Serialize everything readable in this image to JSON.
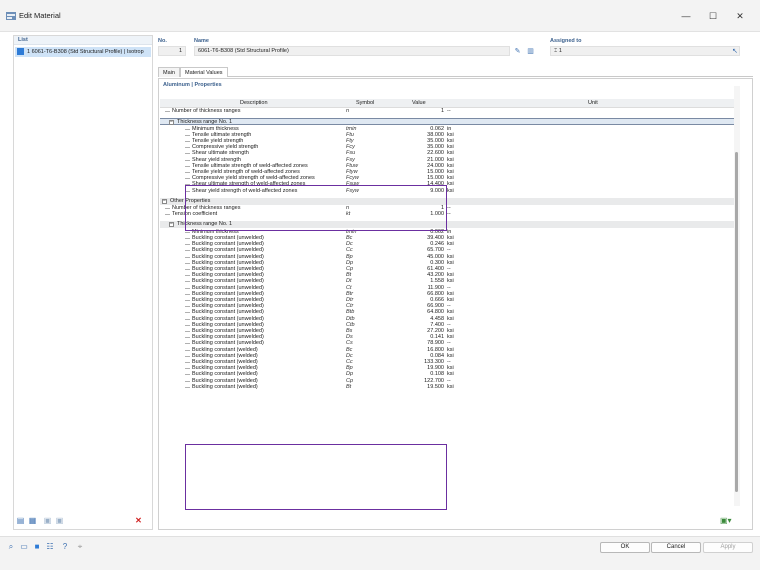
{
  "window": {
    "title": "Edit Material",
    "minimize_glyph": "—",
    "maximize_glyph": "☐",
    "close_glyph": "✕"
  },
  "list_panel": {
    "header": "List",
    "items": [
      {
        "label": "1  6061-T6-B308 (Std Structural Profile) | Isotrop"
      }
    ]
  },
  "header_fields": {
    "no_label": "No.",
    "no_value": "1",
    "name_label": "Name",
    "name_value": "6061-T6-B308 (Std Structural Profile)",
    "assigned_label": "Assigned to",
    "assigned_value": "1"
  },
  "tabs": [
    {
      "label": "Main"
    },
    {
      "label": "Material Values"
    }
  ],
  "section_title": "Aluminum | Properties",
  "columns": {
    "description": "Description",
    "symbol": "Symbol",
    "value": "Value",
    "unit": "Unit"
  },
  "rows": [
    {
      "desc": "Number of thickness ranges",
      "sym": "n",
      "val": "1",
      "unit": "--",
      "indent": 1
    },
    {
      "desc": "Thickness range No. 1",
      "sym": "",
      "val": "",
      "unit": "",
      "group": true,
      "indent": 0
    },
    {
      "desc": "Minimum thickness",
      "sym": "tmin",
      "val": "0.062",
      "unit": "in",
      "indent": 2
    },
    {
      "desc": "Tensile ultimate strength",
      "sym": "Ftu",
      "val": "38.000",
      "unit": "ksi",
      "indent": 2
    },
    {
      "desc": "Tensile yield strength",
      "sym": "Fty",
      "val": "35.000",
      "unit": "ksi",
      "indent": 2
    },
    {
      "desc": "Compressive yield strength",
      "sym": "Fcy",
      "val": "35.000",
      "unit": "ksi",
      "indent": 2
    },
    {
      "desc": "Shear ultimate strength",
      "sym": "Fsu",
      "val": "22.600",
      "unit": "ksi",
      "indent": 2
    },
    {
      "desc": "Shear yield strength",
      "sym": "Fsy",
      "val": "21.000",
      "unit": "ksi",
      "indent": 2
    },
    {
      "desc": "Tensile ultimate strength of weld-affected zones",
      "sym": "Ftuw",
      "val": "24.000",
      "unit": "ksi",
      "indent": 2
    },
    {
      "desc": "Tensile yield strength of weld-affected zones",
      "sym": "Ftyw",
      "val": "15.000",
      "unit": "ksi",
      "indent": 2
    },
    {
      "desc": "Compressive yield strength of weld-affected zones",
      "sym": "Fcyw",
      "val": "15.000",
      "unit": "ksi",
      "indent": 2
    },
    {
      "desc": "Shear ultimate strength of weld-affected zones",
      "sym": "Fsuw",
      "val": "14.400",
      "unit": "ksi",
      "indent": 2
    },
    {
      "desc": "Shear yield strength of weld-affected zones",
      "sym": "Fsyw",
      "val": "9.000",
      "unit": "ksi",
      "indent": 2
    },
    {
      "desc": "Other Properties",
      "sym": "",
      "val": "",
      "unit": "",
      "group": true,
      "indent": -1
    },
    {
      "desc": "Number of thickness ranges",
      "sym": "n",
      "val": "1",
      "unit": "--",
      "indent": 1
    },
    {
      "desc": "Tension coefficient",
      "sym": "kt",
      "val": "1.000",
      "unit": "--",
      "indent": 1
    },
    {
      "desc": "Thickness range No. 1",
      "sym": "",
      "val": "",
      "unit": "",
      "group": true,
      "indent": 0
    },
    {
      "desc": "Minimum thickness",
      "sym": "tmin",
      "val": "0.062",
      "unit": "in",
      "indent": 2
    },
    {
      "desc": "Buckling constant (unwelded)",
      "sym": "Bc",
      "val": "39.400",
      "unit": "ksi",
      "indent": 2
    },
    {
      "desc": "Buckling constant (unwelded)",
      "sym": "Dc",
      "val": "0.246",
      "unit": "ksi",
      "indent": 2
    },
    {
      "desc": "Buckling constant (unwelded)",
      "sym": "Cc",
      "val": "65.700",
      "unit": "--",
      "indent": 2
    },
    {
      "desc": "Buckling constant (unwelded)",
      "sym": "Bp",
      "val": "45.000",
      "unit": "ksi",
      "indent": 2
    },
    {
      "desc": "Buckling constant (unwelded)",
      "sym": "Dp",
      "val": "0.300",
      "unit": "ksi",
      "indent": 2
    },
    {
      "desc": "Buckling constant (unwelded)",
      "sym": "Cp",
      "val": "61.400",
      "unit": "--",
      "indent": 2
    },
    {
      "desc": "Buckling constant (unwelded)",
      "sym": "Bt",
      "val": "43.200",
      "unit": "ksi",
      "indent": 2
    },
    {
      "desc": "Buckling constant (unwelded)",
      "sym": "Dt",
      "val": "1.558",
      "unit": "ksi",
      "indent": 2
    },
    {
      "desc": "Buckling constant (unwelded)",
      "sym": "Ct",
      "val": "11.900",
      "unit": "--",
      "indent": 2
    },
    {
      "desc": "Buckling constant (unwelded)",
      "sym": "Btr",
      "val": "66.800",
      "unit": "ksi",
      "indent": 2
    },
    {
      "desc": "Buckling constant (unwelded)",
      "sym": "Dtr",
      "val": "0.666",
      "unit": "ksi",
      "indent": 2
    },
    {
      "desc": "Buckling constant (unwelded)",
      "sym": "Ctr",
      "val": "66.900",
      "unit": "--",
      "indent": 2
    },
    {
      "desc": "Buckling constant (unwelded)",
      "sym": "Btb",
      "val": "64.800",
      "unit": "ksi",
      "indent": 2
    },
    {
      "desc": "Buckling constant (unwelded)",
      "sym": "Dtb",
      "val": "4.458",
      "unit": "ksi",
      "indent": 2
    },
    {
      "desc": "Buckling constant (unwelded)",
      "sym": "Ctb",
      "val": "7.400",
      "unit": "--",
      "indent": 2
    },
    {
      "desc": "Buckling constant (unwelded)",
      "sym": "Bs",
      "val": "27.200",
      "unit": "ksi",
      "indent": 2
    },
    {
      "desc": "Buckling constant (unwelded)",
      "sym": "Ds",
      "val": "0.141",
      "unit": "ksi",
      "indent": 2
    },
    {
      "desc": "Buckling constant (unwelded)",
      "sym": "Cs",
      "val": "78.900",
      "unit": "--",
      "indent": 2
    },
    {
      "desc": "Buckling constant (welded)",
      "sym": "Bc",
      "val": "16.800",
      "unit": "ksi",
      "indent": 2
    },
    {
      "desc": "Buckling constant (welded)",
      "sym": "Dc",
      "val": "0.084",
      "unit": "ksi",
      "indent": 2
    },
    {
      "desc": "Buckling constant (welded)",
      "sym": "Cc",
      "val": "133.300",
      "unit": "--",
      "indent": 2
    },
    {
      "desc": "Buckling constant (welded)",
      "sym": "Bp",
      "val": "19.900",
      "unit": "ksi",
      "indent": 2
    },
    {
      "desc": "Buckling constant (welded)",
      "sym": "Dp",
      "val": "0.108",
      "unit": "ksi",
      "indent": 2
    },
    {
      "desc": "Buckling constant (welded)",
      "sym": "Cp",
      "val": "122.700",
      "unit": "--",
      "indent": 2
    },
    {
      "desc": "Buckling constant (welded)",
      "sym": "Bt",
      "val": "19.500",
      "unit": "ksi",
      "indent": 2
    }
  ],
  "buttons": {
    "ok": "OK",
    "cancel": "Cancel",
    "apply": "Apply"
  },
  "colors": {
    "accent": "#3a5f8c",
    "highlight": "#6b2fa0",
    "selection": "#cfe3f7"
  }
}
